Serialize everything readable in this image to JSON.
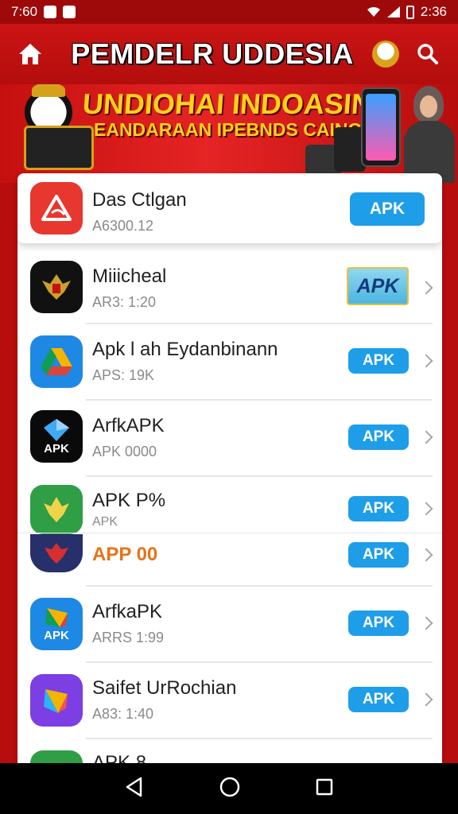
{
  "status_bar": {
    "time_left": "7:60",
    "time_right": "2:36"
  },
  "header": {
    "title": "PEMDELR UDDESIA"
  },
  "banner": {
    "line1": "UNDIOHAI INDOASIN",
    "line2": "EANDARAAN IPEBNDS CAINGM!"
  },
  "apps": [
    {
      "name": "Das Ctlgan",
      "sub": "A6300.12",
      "button": "APK",
      "icon": "triangle-app-icon",
      "color": "#e8372e"
    },
    {
      "name": "Miiicheal",
      "sub": "AR3: 1:20",
      "button": "APK",
      "icon": "garuda-emblem-icon",
      "color": "#111111"
    },
    {
      "name": "Apk l ah Eydanbinann",
      "sub": "APS: 19K",
      "button": "APK",
      "icon": "drive-triangle-icon",
      "color": "#1e88e5"
    },
    {
      "name": "ArfkAPK",
      "sub": "APK 0000",
      "button": "APK",
      "icon": "apk-diamond-icon",
      "color": "#0a0a0a",
      "icon_text": "APK"
    },
    {
      "name": "APK P%",
      "sub": "APK",
      "button": "APK",
      "icon": "green-garuda-icon",
      "color": "#2f9e45"
    },
    {
      "name": "APP 00",
      "sub": "",
      "button": "APK",
      "icon": "red-garuda-icon",
      "color": "#27306b"
    },
    {
      "name": "ArfkaPK",
      "sub": "ARRS 1:99",
      "button": "APK",
      "icon": "apk-kite-icon",
      "color": "#1e88e5",
      "icon_text": "APK"
    },
    {
      "name": "Saifet UrRochian",
      "sub": "A83: 1:40",
      "button": "APK",
      "icon": "purple-kite-icon",
      "color": "#7b3fe4"
    },
    {
      "name": "APK 8",
      "sub": "",
      "button": "",
      "icon": "green-partial-icon",
      "color": "#2f9e45"
    }
  ],
  "colors": {
    "primary_red": "#c41111",
    "apk_blue": "#1e9ee8"
  }
}
